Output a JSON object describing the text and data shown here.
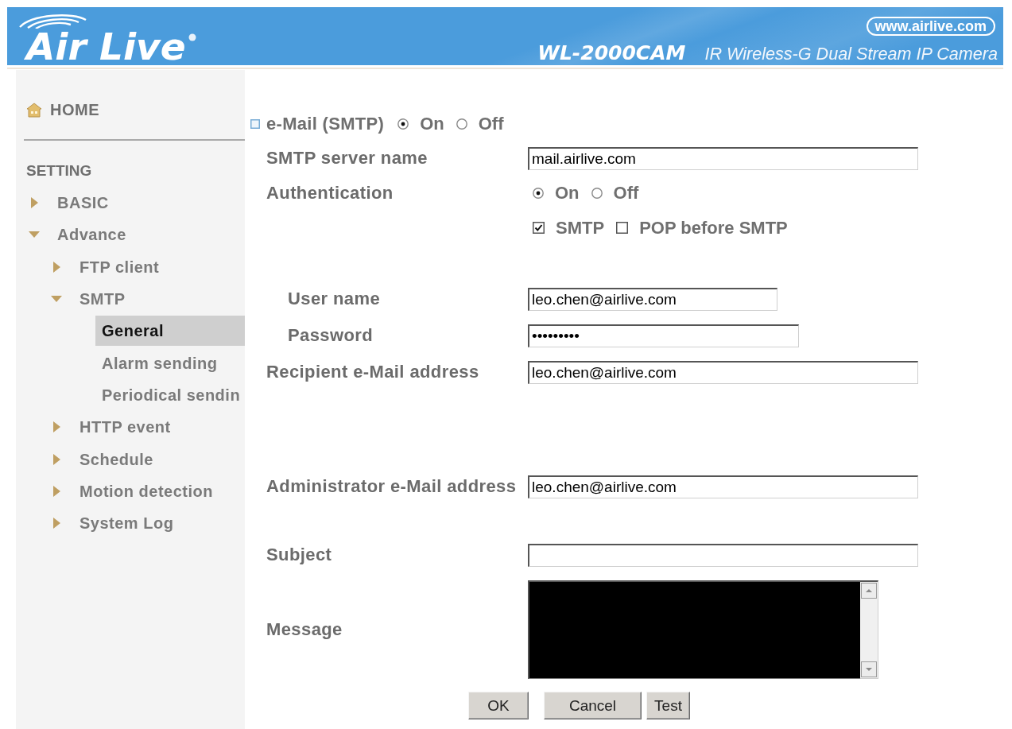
{
  "header": {
    "logo": "Air Live",
    "website": "www.airlive.com",
    "model": "WL-2000CAM",
    "product": "IR Wireless-G Dual Stream IP Camera"
  },
  "sidebar": {
    "home": "HOME",
    "heading": "SETTING",
    "items": [
      {
        "label": "BASIC",
        "expanded": false,
        "selected": false
      },
      {
        "label": "Advance",
        "expanded": true,
        "selected": false,
        "children": [
          {
            "label": "FTP client",
            "expanded": false,
            "selected": false
          },
          {
            "label": "SMTP",
            "expanded": true,
            "selected": false,
            "children": [
              {
                "label": "General",
                "selected": true
              },
              {
                "label": "Alarm sending",
                "selected": false
              },
              {
                "label": "Periodical sendin",
                "selected": false
              }
            ]
          },
          {
            "label": "HTTP event",
            "expanded": false,
            "selected": false
          },
          {
            "label": "Schedule",
            "expanded": false,
            "selected": false
          },
          {
            "label": "Motion detection",
            "expanded": false,
            "selected": false
          },
          {
            "label": "System Log",
            "expanded": false,
            "selected": false
          }
        ]
      }
    ]
  },
  "email": {
    "label": "e-Mail (SMTP)",
    "options": [
      {
        "label": "On",
        "selected": true
      },
      {
        "label": "Off",
        "selected": false
      }
    ]
  },
  "smtp_server": {
    "label": "SMTP server name",
    "value": "mail.airlive.com"
  },
  "authentication": {
    "label": "Authentication",
    "options": [
      {
        "label": "On",
        "selected": true
      },
      {
        "label": "Off",
        "selected": false
      }
    ],
    "methods": [
      {
        "label": "SMTP",
        "checked": true
      },
      {
        "label": "POP before SMTP",
        "checked": false
      }
    ],
    "fields": [
      {
        "label": "User name",
        "value": "leo.chen@airlive.com"
      },
      {
        "label": "Password",
        "value": "•••••••••"
      }
    ]
  },
  "recipient": {
    "label": "Recipient e-Mail address",
    "value": "leo.chen@airlive.com"
  },
  "administrator": {
    "label": "Administrator e-Mail address",
    "value": "leo.chen@airlive.com"
  },
  "subject": {
    "label": "Subject"
  },
  "message": {
    "label": "Message"
  },
  "buttons": [
    "OK",
    "Cancel",
    "Test"
  ]
}
